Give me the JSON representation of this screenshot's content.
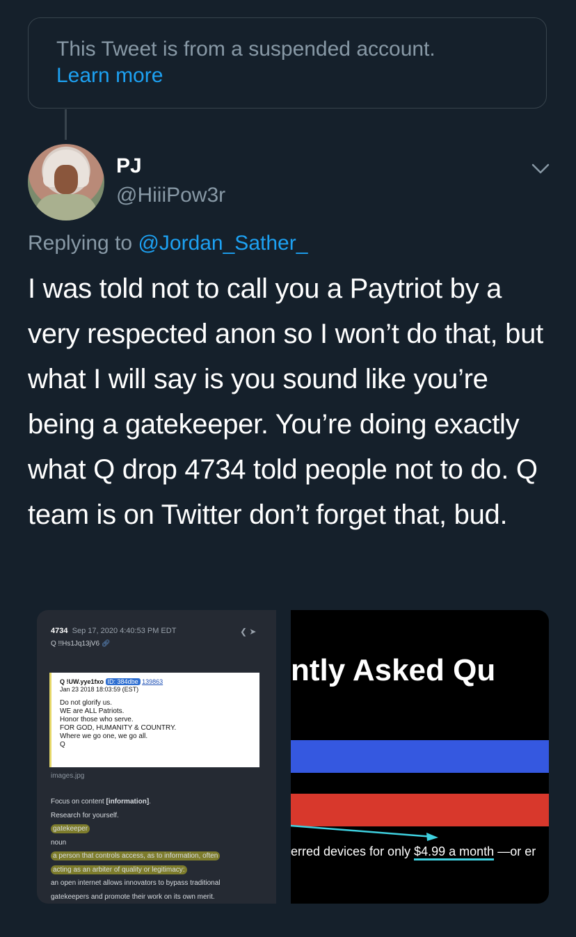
{
  "suspended_notice": {
    "message": "This Tweet is from a suspended account.",
    "learn_more": "Learn more"
  },
  "author": {
    "name": "PJ",
    "handle": "@HiiiPow3r"
  },
  "reply_context": {
    "prefix": "Replying to ",
    "mention": "@Jordan_Sather_"
  },
  "tweet_text": "I was told not to call you a Paytriot by a very respected anon so I won’t do that, but what I will say is you sound like you’re being a gatekeeper. You’re doing exactly what Q drop 4734 told people not to do. Q team is on Twitter don’t forget that, bud.",
  "media": {
    "image1": {
      "post_number": "4734",
      "post_date": "Sep 17, 2020 4:40:53 PM EDT",
      "tripcode": "Q !!Hs1Jq13jV6",
      "quoted": {
        "author": "Q !UW.yye1fxo",
        "id_badge": "ID: 384dbe",
        "ref_number": "139863",
        "date": "Jan 23 2018 18:03:59 (EST)",
        "lines": [
          "Do not glorify us.",
          "WE are ALL Patriots.",
          "Honor those who serve.",
          "FOR GOD, HUMANITY & COUNTRY.",
          "Where we go one, we go all.",
          "Q"
        ]
      },
      "filename": "images.jpg",
      "focus_prefix": "Focus on content ",
      "focus_bold": "[information]",
      "focus_suffix": ".",
      "research": "Research for yourself.",
      "word": "gatekeeper",
      "pos": "noun",
      "definition_line1": "a person that controls access, as to information, often",
      "definition_line2": "acting as an arbiter of quality or legitimacy:",
      "example_line1": "an open internet allows innovators to bypass traditional",
      "example_line2": "gatekeepers and promote their work on its own merit."
    },
    "image2": {
      "heading": "ntly Asked Qu",
      "price_prefix": "erred devices for only ",
      "price_amount": "$4.99 a month",
      "price_suffix": " —or er",
      "colors": {
        "blue_bar": "#3558e0",
        "red_bar": "#d8382c",
        "arrow": "#3fd1e0"
      }
    }
  },
  "colors": {
    "background": "#15202b",
    "link": "#1da1f2",
    "secondary_text": "#8899a6",
    "border": "#38444d"
  }
}
